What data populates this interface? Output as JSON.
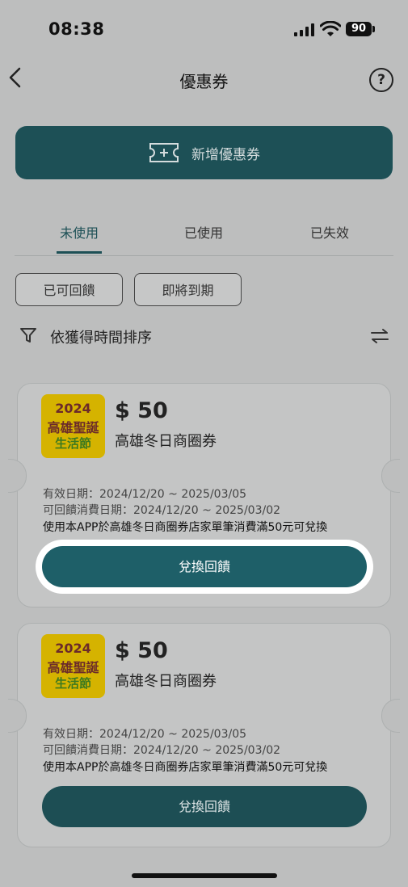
{
  "status_bar": {
    "time": "08:38",
    "battery": "90"
  },
  "header": {
    "title": "優惠券",
    "help": "?"
  },
  "add_button": {
    "label": "新增優惠券"
  },
  "tabs": [
    {
      "label": "未使用",
      "active": true
    },
    {
      "label": "已使用",
      "active": false
    },
    {
      "label": "已失效",
      "active": false
    }
  ],
  "chips": [
    "已可回饋",
    "即將到期"
  ],
  "sort": {
    "label": "依獲得時間排序"
  },
  "coupons": [
    {
      "logo": {
        "year": "2024",
        "line1": "高雄聖誕",
        "line2": "生活節"
      },
      "amount": "$ 50",
      "name": "高雄冬日商圈券",
      "valid": "有效日期：2024/12/20 ~ 2025/03/05",
      "redeem_period": "可回饋消費日期：2024/12/20 ~ 2025/03/02",
      "condition": "使用本APP於高雄冬日商圈券店家單筆消費滿50元可兌換",
      "button": "兌換回饋"
    },
    {
      "logo": {
        "year": "2024",
        "line1": "高雄聖誕",
        "line2": "生活節"
      },
      "amount": "$ 50",
      "name": "高雄冬日商圈券",
      "valid": "有效日期：2024/12/20 ~ 2025/03/05",
      "redeem_period": "可回饋消費日期：2024/12/20 ~ 2025/03/02",
      "condition": "使用本APP於高雄冬日商圈券店家單筆消費滿50元可兌換",
      "button": "兌換回饋"
    }
  ],
  "colors": {
    "primary": "#1d5056",
    "background": "#bdbebe",
    "logo_bg": "#d5b300"
  }
}
